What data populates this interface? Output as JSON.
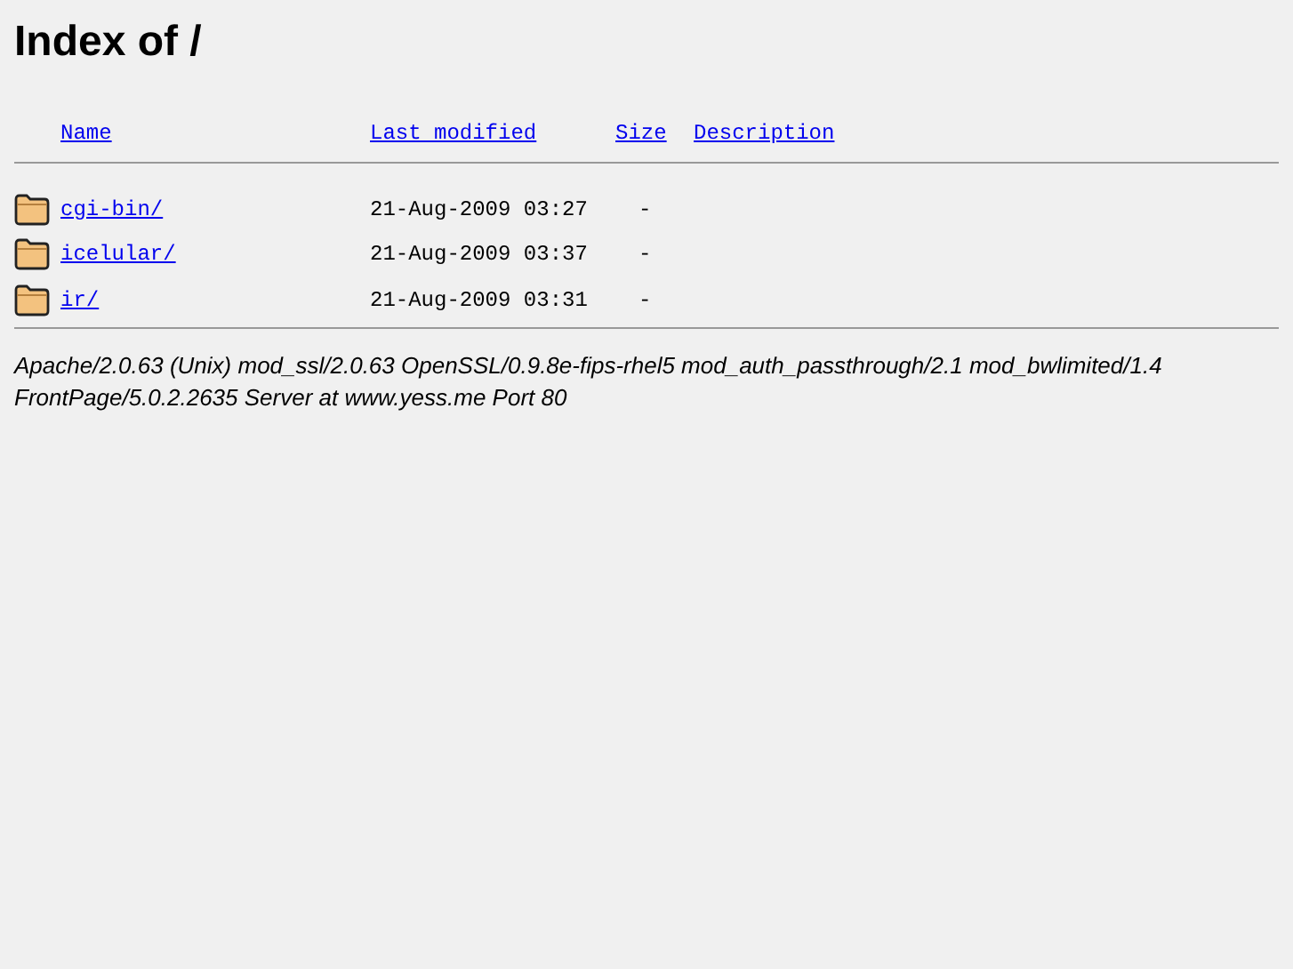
{
  "title": "Index of /",
  "columns": [
    "Name",
    "Last modified",
    "Size",
    "Description"
  ],
  "rows": [
    {
      "name": "cgi-bin/",
      "modified": "21-Aug-2009 03:27",
      "size": "-"
    },
    {
      "name": "icelular/",
      "modified": "21-Aug-2009 03:37",
      "size": "-"
    },
    {
      "name": "ir/",
      "modified": "21-Aug-2009 03:31",
      "size": "-"
    }
  ],
  "address": "Apache/2.0.63 (Unix) mod_ssl/2.0.63 OpenSSL/0.9.8e-fips-rhel5 mod_auth_passthrough/2.1 mod_bwlimited/1.4 FrontPage/5.0.2.2635 Server at www.yess.me Port 80"
}
